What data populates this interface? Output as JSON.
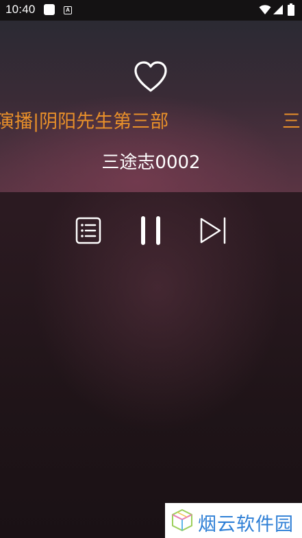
{
  "status_bar": {
    "time": "10:40",
    "a_indicator": "A",
    "icons": [
      "notification-icon",
      "a-icon",
      "wifi-icon",
      "signal-icon",
      "battery-icon"
    ]
  },
  "now_playing": {
    "album_title": "演播|阴阳先生第三部",
    "album_title_repeat": "三",
    "track_name": "三途志0002",
    "liked": false
  },
  "controls": {
    "playlist_icon": "playlist-icon",
    "pause_icon": "pause-icon",
    "next_icon": "skip-next-icon"
  },
  "watermark": {
    "text": "烟云软件园"
  },
  "colors": {
    "accent_orange": "#e9902a",
    "watermark_blue": "#2e7fd6",
    "status_bar_bg": "#141213"
  }
}
